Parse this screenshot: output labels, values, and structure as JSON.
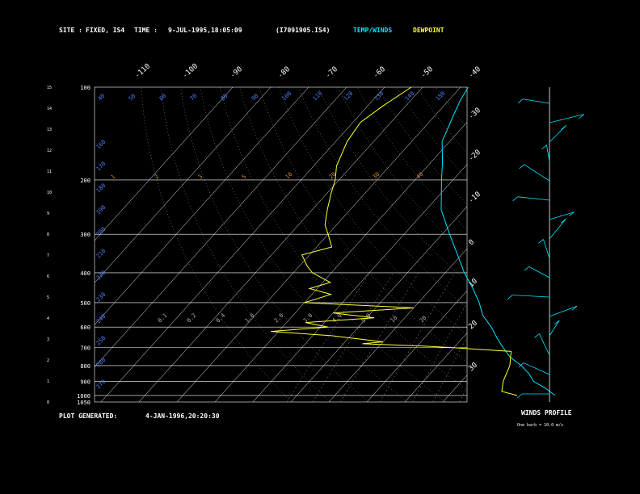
{
  "header": {
    "site_label": "SITE :",
    "site_value": "FIXED, IS4",
    "time_label": "TIME :",
    "time_value": "9-JUL-1995,18:05:09",
    "file": "(I7091905.IS4)",
    "temp_label": "TEMP/WINDS",
    "dew_label": "DEWPOINT"
  },
  "footer": {
    "generated_label": "PLOT GENERATED:",
    "generated_value": "4-JAN-1996,20:20:30"
  },
  "winds": {
    "title": "WINDS PROFILE",
    "legend": "One barb = 10.0 m/s"
  },
  "colors": {
    "background": "#000000",
    "text": "#ffffff",
    "temperature": "#00e5ff",
    "dewpoint": "#ffff33",
    "isobar": "#ffffff",
    "dry_adiabat": "#b0b0b0",
    "mixing_ratio": "#d08a3a",
    "wind_barbs": "#00e5ff",
    "isotherm_labels": "#ffffff",
    "height_labels": "#5080ff"
  },
  "chart_data": {
    "type": "skew-t log-p",
    "pressure_levels": [
      400,
      300,
      200,
      100
    ],
    "pressure_labels": [
      "1050",
      "1000",
      "900",
      "800",
      "700",
      "600",
      "500",
      "400",
      "300",
      "200",
      "100"
    ],
    "pressure_label_values": [
      1050,
      1000,
      900,
      800,
      700,
      600,
      500,
      400,
      300,
      200,
      100
    ],
    "height_ticks_km": [
      0,
      1,
      2,
      3,
      4,
      5,
      6,
      7,
      8,
      9,
      10,
      11,
      12,
      13,
      14,
      15
    ],
    "isotherm_top_labels": [
      "-110",
      "-100",
      "-90",
      "-80",
      "-70",
      "-60",
      "-50",
      "-40"
    ],
    "isotherm_top_values": [
      -110,
      -100,
      -90,
      -80,
      -70,
      -60,
      -50,
      -40
    ],
    "isotherm_right_labels": [
      "-30",
      "-20",
      "-10",
      "0",
      "10",
      "20",
      "30"
    ],
    "isotherm_right_values": [
      -30,
      -20,
      -10,
      0,
      10,
      20,
      30
    ],
    "theta_labels": [
      "40",
      "50",
      "60",
      "70",
      "80",
      "90",
      "100",
      "110",
      "120",
      "130",
      "140",
      "150",
      "160",
      "170",
      "180",
      "190",
      "200",
      "210",
      "220",
      "230",
      "240",
      "250",
      "260",
      "270"
    ],
    "mixing_ratio_labels": [
      "1",
      "2",
      "3",
      "5",
      "10",
      "20",
      "30",
      "40",
      "50",
      "70",
      "100",
      "150"
    ],
    "dry_adiabat_labels": [
      "0.1",
      "0.2",
      "0.4",
      "1.0",
      "2.0",
      "3.0",
      "4.0",
      "5.0",
      "10",
      "20"
    ],
    "temperature_profile": [
      {
        "p": 1000,
        "t": 28
      },
      {
        "p": 950,
        "t": 24
      },
      {
        "p": 900,
        "t": 19
      },
      {
        "p": 850,
        "t": 16
      },
      {
        "p": 800,
        "t": 12
      },
      {
        "p": 750,
        "t": 7
      },
      {
        "p": 700,
        "t": 3
      },
      {
        "p": 650,
        "t": -1
      },
      {
        "p": 600,
        "t": -5
      },
      {
        "p": 550,
        "t": -10
      },
      {
        "p": 500,
        "t": -14
      },
      {
        "p": 450,
        "t": -19
      },
      {
        "p": 400,
        "t": -25
      },
      {
        "p": 350,
        "t": -31
      },
      {
        "p": 300,
        "t": -38
      },
      {
        "p": 250,
        "t": -46
      },
      {
        "p": 200,
        "t": -53
      },
      {
        "p": 175,
        "t": -57
      },
      {
        "p": 150,
        "t": -62
      },
      {
        "p": 125,
        "t": -65
      },
      {
        "p": 110,
        "t": -67
      },
      {
        "p": 100,
        "t": -68
      }
    ],
    "dewpoint_profile": [
      {
        "p": 1000,
        "t": 18
      },
      {
        "p": 970,
        "t": 13
      },
      {
        "p": 900,
        "t": 11
      },
      {
        "p": 800,
        "t": 9
      },
      {
        "p": 720,
        "t": 6
      },
      {
        "p": 700,
        "t": -10
      },
      {
        "p": 690,
        "t": -20
      },
      {
        "p": 680,
        "t": -35
      },
      {
        "p": 670,
        "t": -30
      },
      {
        "p": 640,
        "t": -45
      },
      {
        "p": 620,
        "t": -62
      },
      {
        "p": 600,
        "t": -48
      },
      {
        "p": 580,
        "t": -55
      },
      {
        "p": 560,
        "t": -38
      },
      {
        "p": 540,
        "t": -50
      },
      {
        "p": 520,
        "t": -30
      },
      {
        "p": 500,
        "t": -60
      },
      {
        "p": 470,
        "t": -55
      },
      {
        "p": 450,
        "t": -62
      },
      {
        "p": 430,
        "t": -58
      },
      {
        "p": 400,
        "t": -65
      },
      {
        "p": 380,
        "t": -68
      },
      {
        "p": 350,
        "t": -72
      },
      {
        "p": 330,
        "t": -66
      },
      {
        "p": 300,
        "t": -70
      },
      {
        "p": 280,
        "t": -73
      },
      {
        "p": 250,
        "t": -76
      },
      {
        "p": 220,
        "t": -79
      },
      {
        "p": 200,
        "t": -81
      },
      {
        "p": 180,
        "t": -84
      },
      {
        "p": 150,
        "t": -87
      },
      {
        "p": 130,
        "t": -88
      },
      {
        "p": 115,
        "t": -86
      },
      {
        "p": 100,
        "t": -83
      }
    ],
    "wind_profile_levels_count": 16,
    "grid": true
  }
}
